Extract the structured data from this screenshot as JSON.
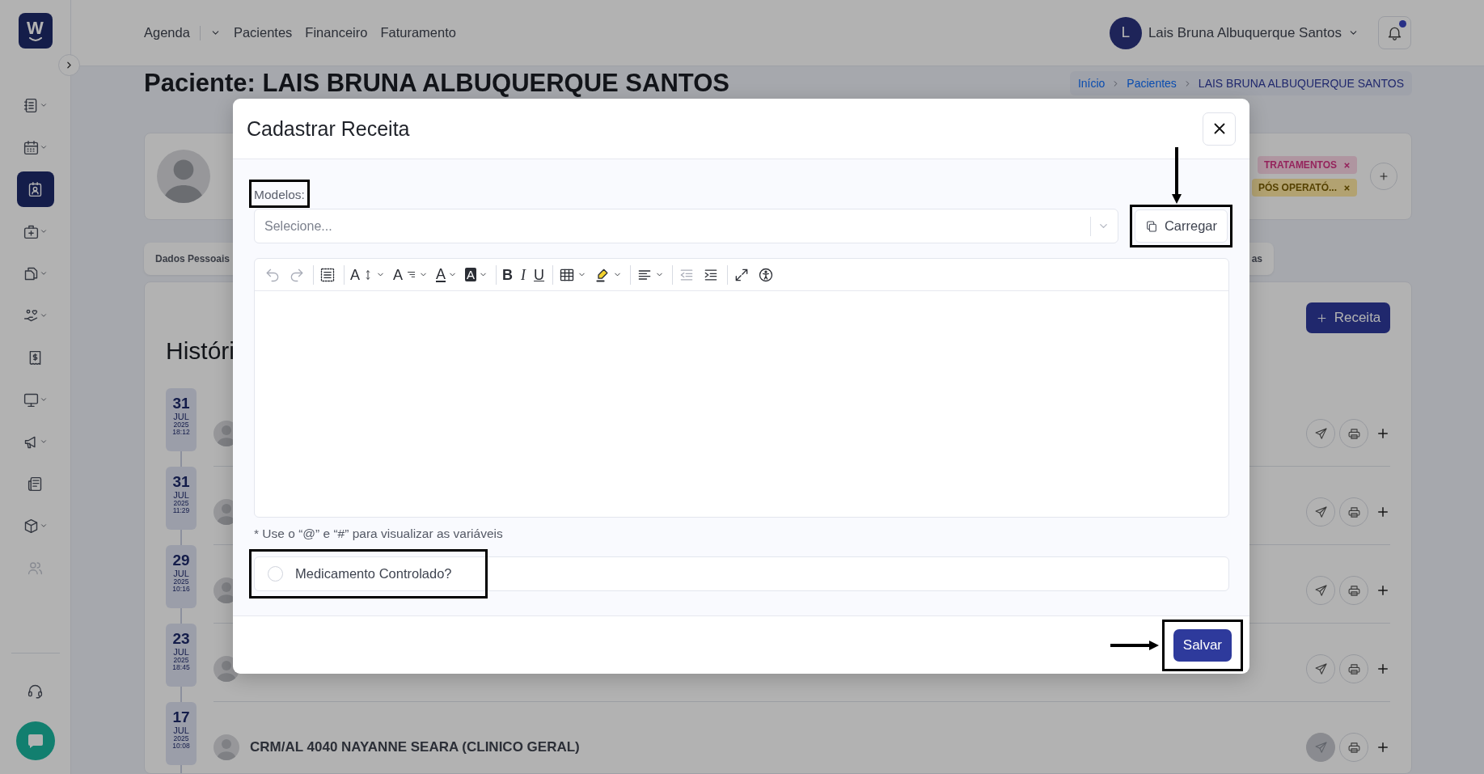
{
  "sidebar": {
    "logo": "W",
    "items": [
      {
        "kind": "notebook",
        "expandable": true,
        "selected": false,
        "disabled": false
      },
      {
        "kind": "calendar",
        "expandable": true,
        "selected": false,
        "disabled": false
      },
      {
        "kind": "patient",
        "expandable": false,
        "selected": true,
        "disabled": false
      },
      {
        "kind": "medkit",
        "expandable": true,
        "selected": false,
        "disabled": false
      },
      {
        "kind": "documents",
        "expandable": true,
        "selected": false,
        "disabled": false
      },
      {
        "kind": "care",
        "expandable": true,
        "selected": false,
        "disabled": false
      },
      {
        "kind": "receipt",
        "expandable": false,
        "selected": false,
        "disabled": false
      },
      {
        "kind": "monitor",
        "expandable": true,
        "selected": false,
        "disabled": false
      },
      {
        "kind": "megaphone",
        "expandable": true,
        "selected": false,
        "disabled": false
      },
      {
        "kind": "newspaper",
        "expandable": false,
        "selected": false,
        "disabled": false
      },
      {
        "kind": "box",
        "expandable": true,
        "selected": false,
        "disabled": false
      },
      {
        "kind": "users",
        "expandable": false,
        "selected": false,
        "disabled": true
      }
    ]
  },
  "nav": [
    {
      "label": "Agenda",
      "dropdown": true
    },
    {
      "label": "Pacientes",
      "dropdown": false
    },
    {
      "label": "Financeiro",
      "dropdown": false
    },
    {
      "label": "Faturamento",
      "dropdown": false
    }
  ],
  "user": {
    "initial": "L",
    "name": "Lais Bruna Albuquerque Santos"
  },
  "notifications": {
    "unread": true
  },
  "page": {
    "title": "Paciente: LAIS BRUNA ALBUQUERQUE SANTOS",
    "breadcrumb": [
      {
        "label": "Início",
        "current": false
      },
      {
        "label": "Pacientes",
        "current": false
      },
      {
        "label": "LAIS BRUNA ALBUQUERQUE SANTOS",
        "current": true
      }
    ]
  },
  "patient_card": {
    "tags": [
      {
        "label": "TRATAMENTOS",
        "kind": "danger"
      },
      {
        "label": "PÓS OPERATÓ...",
        "kind": "warning"
      }
    ]
  },
  "tabs": [
    {
      "label": "Dados Pessoais"
    },
    {
      "label": "as"
    }
  ],
  "history": {
    "title": "Históri",
    "new_button": "Receita",
    "entries": [
      {
        "day": "31",
        "month": "JUL",
        "year": "2025",
        "time": "18:12",
        "send_enabled": true
      },
      {
        "day": "31",
        "month": "JUL",
        "year": "2025",
        "time": "11:29",
        "send_enabled": true
      },
      {
        "day": "29",
        "month": "JUL",
        "year": "2025",
        "time": "10:16",
        "send_enabled": true
      },
      {
        "day": "23",
        "month": "JUL",
        "year": "2025",
        "time": "18:45",
        "send_enabled": true
      },
      {
        "day": "17",
        "month": "JUL",
        "year": "2025",
        "time": "10:08",
        "author": "CRM/AL 4040 NAYANNE SEARA (CLINICO GERAL)",
        "send_enabled": false
      }
    ]
  },
  "modal": {
    "title": "Cadastrar Receita",
    "models_label": "Modelos:",
    "models_highlighted": true,
    "models_placeholder": "Selecione...",
    "load_button": "Carregar",
    "load_highlighted": true,
    "load_arrow": true,
    "toolbar": [
      {
        "kind": "undo",
        "dropdown": false,
        "disabled": true,
        "separator_before": false
      },
      {
        "kind": "redo",
        "dropdown": false,
        "disabled": true,
        "separator_before": false
      },
      {
        "kind": "select_all",
        "dropdown": false,
        "disabled": false,
        "separator_before": true
      },
      {
        "kind": "font_size",
        "glyph": "A",
        "dropdown": true,
        "disabled": false,
        "separator_before": true
      },
      {
        "kind": "text_style",
        "glyph": "A",
        "dropdown": true,
        "disabled": false,
        "separator_before": false
      },
      {
        "kind": "font_color",
        "glyph": "A",
        "dropdown": true,
        "disabled": false,
        "separator_before": false
      },
      {
        "kind": "background_color",
        "glyph": "A",
        "dropdown": true,
        "disabled": false,
        "separator_before": false
      },
      {
        "kind": "bold",
        "glyph": "B",
        "dropdown": false,
        "disabled": false,
        "separator_before": true
      },
      {
        "kind": "italic",
        "glyph": "I",
        "dropdown": false,
        "disabled": false,
        "separator_before": false
      },
      {
        "kind": "underline",
        "glyph": "U",
        "dropdown": false,
        "disabled": false,
        "separator_before": false
      },
      {
        "kind": "table",
        "dropdown": true,
        "disabled": false,
        "separator_before": true
      },
      {
        "kind": "highlight",
        "dropdown": true,
        "disabled": false,
        "separator_before": false
      },
      {
        "kind": "align",
        "dropdown": true,
        "disabled": false,
        "separator_before": true
      },
      {
        "kind": "outdent",
        "dropdown": false,
        "disabled": true,
        "separator_before": true
      },
      {
        "kind": "indent",
        "dropdown": false,
        "disabled": false,
        "separator_before": false
      },
      {
        "kind": "fullscreen",
        "dropdown": false,
        "disabled": false,
        "separator_before": true
      },
      {
        "kind": "accessibility",
        "dropdown": false,
        "disabled": false,
        "separator_before": false
      }
    ],
    "hint": "* Use o “@” e “#” para visualizar as variáveis",
    "controlled": {
      "label": "Medicamento Controlado?",
      "checked": false,
      "highlighted": true
    },
    "save_button": "Salvar",
    "save_highlighted": true,
    "save_arrow": true
  }
}
